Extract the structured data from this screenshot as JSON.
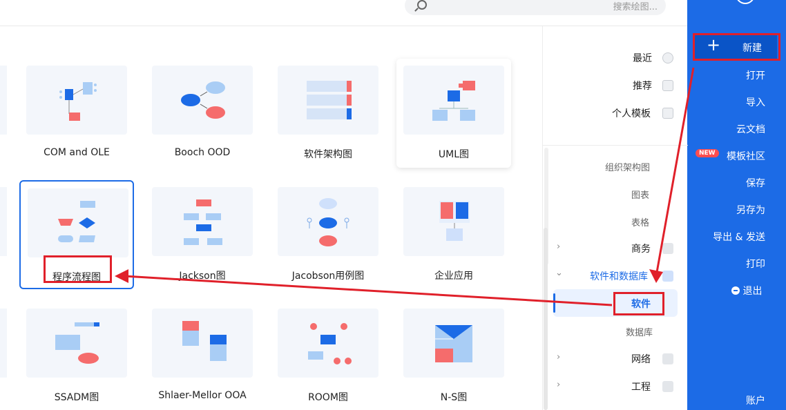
{
  "search": {
    "placeholder": "搜索绘图..."
  },
  "nav": {
    "new_label": "新建",
    "items": [
      "打开",
      "导入",
      "云文档",
      "模板社区",
      "保存",
      "另存为",
      "导出 & 发送",
      "打印",
      "退出"
    ],
    "new_badge": "NEW",
    "account": "账户"
  },
  "sidebar": {
    "top": [
      "最近",
      "推荐",
      "个人模板"
    ],
    "sub_a": [
      "组织架构图",
      "图表",
      "表格"
    ],
    "business": "商务",
    "software_db": "软件和数据库",
    "software": "软件",
    "database": "数据库",
    "network": "网络",
    "engineering": "工程"
  },
  "cards": {
    "row1": [
      "UML图",
      "软件架构图",
      "Booch OOD",
      "COM and OLE"
    ],
    "row2": [
      "企业应用",
      "Jacobson用例图",
      "Jackson图",
      "程序流程图"
    ],
    "row3": [
      "N-S图",
      "ROOM图",
      "Shlaer-Mellor OOA",
      "SSADM图"
    ]
  },
  "colors": {
    "accent": "#1c6be6",
    "annotation": "#e0202a",
    "thumb_red": "#f56c6c",
    "thumb_blue": "#a9cdf5"
  }
}
